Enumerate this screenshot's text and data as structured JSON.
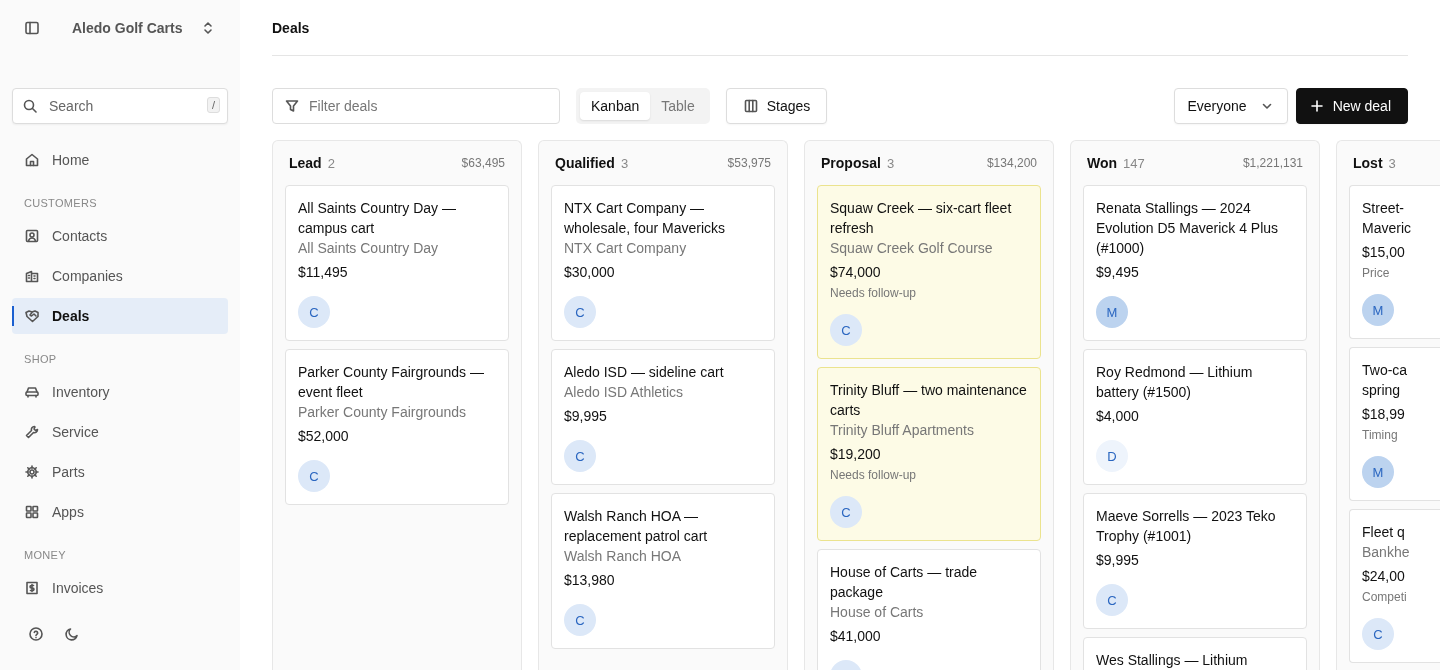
{
  "sidebar": {
    "workspace": "Aledo Golf Carts",
    "search": {
      "placeholder": "Search",
      "shortcut": "/"
    },
    "sections": [
      {
        "items": [
          {
            "label": "Home",
            "selected": false
          }
        ]
      },
      {
        "heading": "CUSTOMERS",
        "items": [
          {
            "label": "Contacts",
            "selected": false
          },
          {
            "label": "Companies",
            "selected": false
          },
          {
            "label": "Deals",
            "selected": true
          }
        ]
      },
      {
        "heading": "SHOP",
        "items": [
          {
            "label": "Inventory",
            "selected": false
          },
          {
            "label": "Service",
            "selected": false
          },
          {
            "label": "Parts",
            "selected": false
          },
          {
            "label": "Apps",
            "selected": false
          }
        ]
      },
      {
        "heading": "MONEY",
        "items": [
          {
            "label": "Invoices",
            "selected": false
          }
        ]
      }
    ]
  },
  "page": {
    "title": "Deals"
  },
  "toolbar": {
    "filter": {
      "placeholder": "Filter deals"
    },
    "views": [
      {
        "label": "Kanban",
        "selected": true
      },
      {
        "label": "Table",
        "selected": false
      }
    ],
    "stages_button": "Stages",
    "owner_select": "Everyone",
    "new_button": "New deal"
  },
  "columns": [
    {
      "name": "Lead",
      "count": "2",
      "total": "$63,495",
      "partial": false,
      "cards": [
        {
          "title": "All Saints Country Day — campus cart",
          "company": "All Saints Country Day",
          "amount": "$11,495",
          "flagged": false,
          "avatar": {
            "initial": "C",
            "color": "#dce8f8"
          }
        },
        {
          "title": "Parker County Fairgrounds — event fleet",
          "company": "Parker County Fairgrounds",
          "amount": "$52,000",
          "flagged": false,
          "avatar": {
            "initial": "C",
            "color": "#dce8f8"
          }
        }
      ]
    },
    {
      "name": "Qualified",
      "count": "3",
      "total": "$53,975",
      "partial": false,
      "cards": [
        {
          "title": "NTX Cart Company — wholesale, four Mavericks",
          "company": "NTX Cart Company",
          "amount": "$30,000",
          "flagged": false,
          "avatar": {
            "initial": "C",
            "color": "#dce8f8"
          }
        },
        {
          "title": "Aledo ISD — sideline cart",
          "company": "Aledo ISD Athletics",
          "amount": "$9,995",
          "flagged": false,
          "avatar": {
            "initial": "C",
            "color": "#dce8f8"
          }
        },
        {
          "title": "Walsh Ranch HOA — replacement patrol cart",
          "company": "Walsh Ranch HOA",
          "amount": "$13,980",
          "flagged": false,
          "avatar": {
            "initial": "C",
            "color": "#dce8f8"
          }
        }
      ]
    },
    {
      "name": "Proposal",
      "count": "3",
      "total": "$134,200",
      "partial": false,
      "cards": [
        {
          "title": "Squaw Creek — six-cart fleet refresh",
          "company": "Squaw Creek Golf Course",
          "amount": "$74,000",
          "note": "Needs follow-up",
          "flagged": true,
          "avatar": {
            "initial": "C",
            "color": "#dce8f8"
          }
        },
        {
          "title": "Trinity Bluff — two maintenance carts",
          "company": "Trinity Bluff Apartments",
          "amount": "$19,200",
          "note": "Needs follow-up",
          "flagged": true,
          "avatar": {
            "initial": "C",
            "color": "#dce8f8"
          }
        },
        {
          "title": "House of Carts — trade package",
          "company": "House of Carts",
          "amount": "$41,000",
          "flagged": false,
          "avatar": {
            "color": "#dce8f8"
          }
        }
      ]
    },
    {
      "name": "Won",
      "count": "147",
      "total": "$1,221,131",
      "partial": false,
      "cards": [
        {
          "title": "Renata Stallings — 2024 Evolution D5 Maverick 4 Plus (#1000)",
          "amount": "$9,495",
          "flagged": false,
          "avatar": {
            "initial": "M",
            "color": "#bcd3ef"
          }
        },
        {
          "title": "Roy Redmond — Lithium battery (#1500)",
          "amount": "$4,000",
          "flagged": false,
          "avatar": {
            "initial": "D",
            "color": "#eef4fc"
          }
        },
        {
          "title": "Maeve Sorrells — 2023 Teko Trophy (#1001)",
          "amount": "$9,995",
          "flagged": false,
          "avatar": {
            "initial": "C",
            "color": "#dce8f8"
          }
        },
        {
          "title": "Wes Stallings — Lithium",
          "flagged": false
        }
      ]
    },
    {
      "name": "Lost",
      "count": "3",
      "partial": true,
      "cards": [
        {
          "title": "Street- Maveric",
          "amount": "$15,00",
          "note": "Price",
          "flagged": false,
          "avatar": {
            "initial": "M",
            "color": "#bcd3ef"
          }
        },
        {
          "title": "Two-ca spring",
          "amount": "$18,99",
          "note": "Timing",
          "flagged": false,
          "avatar": {
            "initial": "M",
            "color": "#bcd3ef"
          }
        },
        {
          "title": "Fleet q",
          "company": "Bankhe",
          "amount": "$24,00",
          "note": "Competi",
          "flagged": false,
          "avatar": {
            "initial": "C",
            "color": "#dce8f8"
          }
        }
      ]
    }
  ]
}
